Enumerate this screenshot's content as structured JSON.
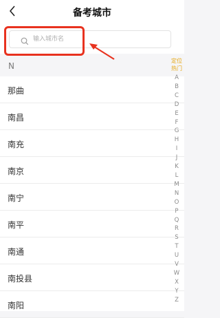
{
  "header": {
    "back_icon": "chevron-left-icon",
    "title": "备考城市"
  },
  "search": {
    "placeholder": "输入城市名",
    "value": ""
  },
  "section": {
    "letter": "N"
  },
  "cities": [
    "那曲",
    "南昌",
    "南充",
    "南京",
    "南宁",
    "南平",
    "南通",
    "南投县",
    "南阳"
  ],
  "index": {
    "locate": "定位",
    "hot": "热门",
    "letters": [
      "A",
      "B",
      "C",
      "D",
      "E",
      "F",
      "G",
      "H",
      "I",
      "J",
      "K",
      "L",
      "M",
      "N",
      "O",
      "P",
      "Q",
      "R",
      "S",
      "T",
      "U",
      "V",
      "W",
      "X",
      "Y",
      "Z"
    ]
  },
  "annotation": {
    "color": "#e8321f"
  }
}
